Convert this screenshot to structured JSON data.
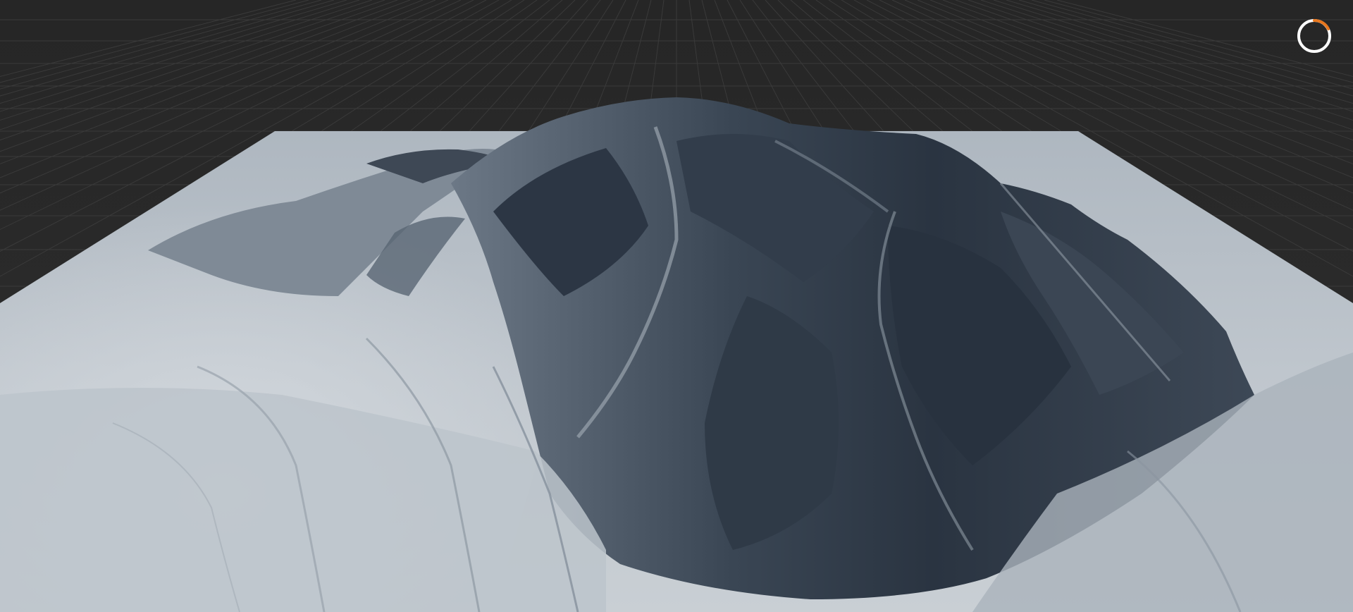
{
  "viewport": {
    "background_color": "#2a2a2a",
    "grid_color": "#3a3a3a",
    "terrain_light_color": "#c3cad0",
    "terrain_mid_color": "#8f9aa4",
    "terrain_dark_color": "#27313d"
  },
  "loading_indicator": {
    "icon": "spinner-ring-icon",
    "ring_color": "#ffffff",
    "accent_color": "#e8771e",
    "state": "loading"
  }
}
